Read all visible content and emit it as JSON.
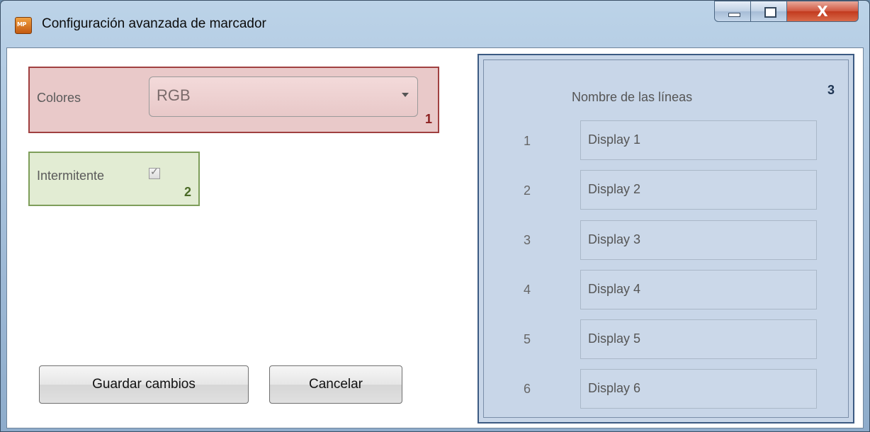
{
  "window": {
    "title": "Configuración avanzada de marcador",
    "app_icon_text": "MP"
  },
  "title_buttons": {
    "close_glyph": "X"
  },
  "section1": {
    "label": "Colores",
    "combo_value": "RGB",
    "tag": "1",
    "border_color": "#a04040",
    "fill_color": "#e9c9c9"
  },
  "section2": {
    "label": "Intermitente",
    "checked": true,
    "check_glyph": "✓",
    "tag": "2",
    "border_color": "#7e9e5a",
    "fill_color": "#e2ecd3"
  },
  "buttons": {
    "save": "Guardar cambios",
    "cancel": "Cancelar"
  },
  "section3": {
    "heading": "Nombre de las líneas",
    "tag": "3",
    "border_color": "#3c5a82",
    "fill_color": "#c8d6e8",
    "rows": [
      {
        "num": "1",
        "value": "Display 1"
      },
      {
        "num": "2",
        "value": "Display 2"
      },
      {
        "num": "3",
        "value": "Display 3"
      },
      {
        "num": "4",
        "value": "Display 4"
      },
      {
        "num": "5",
        "value": "Display 5"
      },
      {
        "num": "6",
        "value": "Display 6"
      }
    ]
  }
}
